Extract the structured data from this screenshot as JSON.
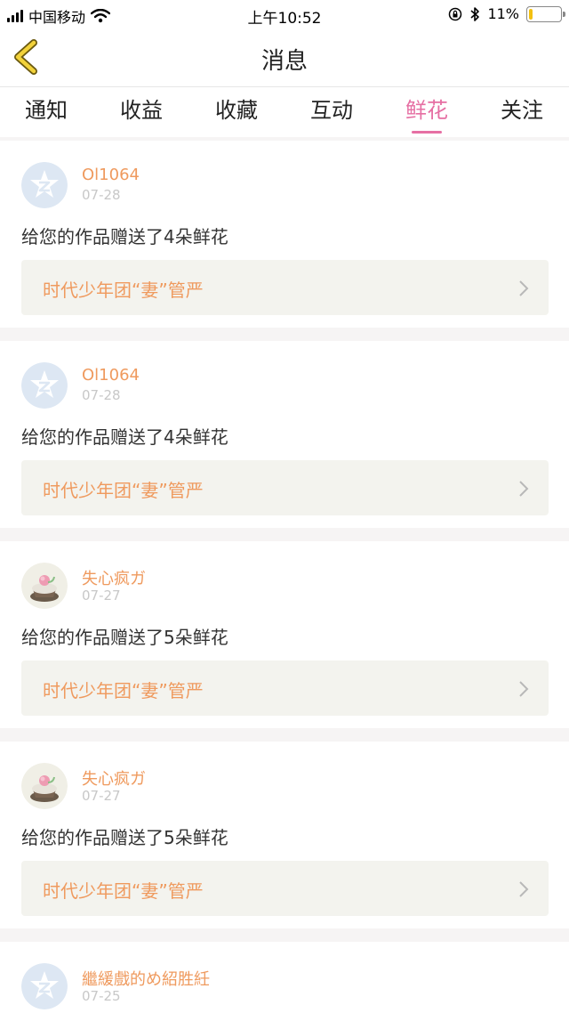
{
  "status_bar": {
    "carrier": "中国移动",
    "time": "上午10:52",
    "battery": "11%",
    "battery_level": 0.11
  },
  "header": {
    "title": "消息"
  },
  "tabs": [
    {
      "label": "通知"
    },
    {
      "label": "收益"
    },
    {
      "label": "收藏"
    },
    {
      "label": "互动"
    },
    {
      "label": "鲜花",
      "active": true
    },
    {
      "label": "关注"
    }
  ],
  "messages": [
    {
      "username": "Ol1064",
      "date": "07-28",
      "text": "给您的作品赠送了4朵鲜花",
      "work_title": "时代少年团“妻”管严",
      "avatar": "default-avatar-icon"
    },
    {
      "username": "Ol1064",
      "date": "07-28",
      "text": "给您的作品赠送了4朵鲜花",
      "work_title": "时代少年团“妻”管严",
      "avatar": "default-avatar-icon"
    },
    {
      "username": "失心疯ガ",
      "date": "07-27",
      "text": "给您的作品赠送了5朵鲜花",
      "work_title": "时代少年团“妻”管严",
      "avatar": "cupcake-avatar"
    },
    {
      "username": "失心疯ガ",
      "date": "07-27",
      "text": "给您的作品赠送了5朵鲜花",
      "work_title": "时代少年团“妻”管严",
      "avatar": "cupcake-avatar"
    },
    {
      "username": "繼緩戲的め紹胜紝",
      "date": "07-25",
      "avatar": "default-avatar-icon"
    }
  ],
  "colors": {
    "accent_pink": "#e66fa3",
    "username_orange": "#ef9a5e",
    "card_link_bg": "#f3f3ee",
    "page_bg": "#f6f4f4"
  }
}
